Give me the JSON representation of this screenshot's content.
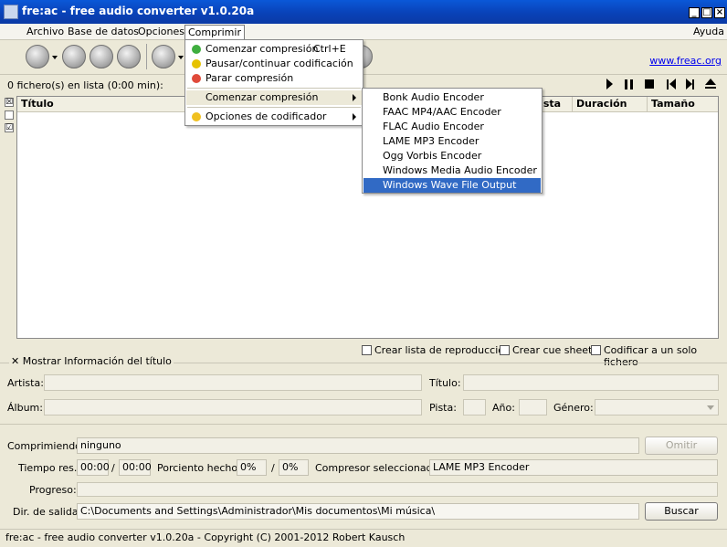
{
  "window": {
    "title": "fre:ac - free audio converter v1.0.20a",
    "controls": {
      "minimize": "_",
      "maximize": "□",
      "close": "×"
    }
  },
  "menubar": {
    "items": [
      "Archivo",
      "Base de datos",
      "Opciones",
      "Comprimir"
    ],
    "help": "Ayuda"
  },
  "link": "www.freac.org",
  "list": {
    "count_text": "0 fichero(s) en lista (0:00 min):",
    "columns": [
      "Título",
      "Pista",
      "Duración",
      "Tamaño"
    ],
    "check_marks": [
      "☒",
      "",
      "☑"
    ]
  },
  "comprimir_menu": {
    "items": [
      {
        "label": "Comenzar compresión",
        "shortcut": "Ctrl+E",
        "icon": "green-play-icon"
      },
      {
        "label": "Pausar/continuar codificación",
        "icon": "yellow-pause-icon"
      },
      {
        "label": "Parar compresión",
        "icon": "red-stop-icon"
      },
      {
        "label": "Comenzar compresión",
        "submenu": true
      },
      {
        "label": "Opciones de codificador",
        "submenu": true,
        "icon": "yellow-gear-icon"
      }
    ]
  },
  "encoder_submenu": {
    "items": [
      "Bonk Audio Encoder",
      "FAAC MP4/AAC Encoder",
      "FLAC Audio Encoder",
      "LAME MP3 Encoder",
      "Ogg Vorbis Encoder",
      "Windows Media Audio Encoder",
      "Windows Wave File Output"
    ],
    "highlighted_index": 6
  },
  "options": {
    "playlist": "Crear lista de reproducción",
    "cue": "Crear cue sheet",
    "single_file": "Codificar a un solo fichero"
  },
  "title_info": {
    "toggle_label": "Mostrar Información del título",
    "toggle_mark": "✕",
    "artist": "Artista:",
    "title": "Título:",
    "album": "Álbum:",
    "track": "Pista:",
    "year": "Año:",
    "genre": "Género:"
  },
  "progress": {
    "compressing_label": "Comprimiendo:",
    "compressing_value": "ninguno",
    "skip_button": "Omitir",
    "time_label": "Tiempo res.:",
    "time1": "00:00",
    "time2": "00:00",
    "slash": "/",
    "percent_label": "Porciento hecho:",
    "percent1": "0%",
    "percent2": "0%",
    "encoder_label": "Compresor seleccionado:",
    "encoder_value": "LAME MP3 Encoder",
    "progress_label": "Progreso:",
    "output_label": "Dir. de salida:",
    "output_value": "C:\\Documents and Settings\\Administrador\\Mis documentos\\Mi música\\",
    "browse_button": "Buscar"
  },
  "statusbar": "fre:ac - free audio converter v1.0.20a - Copyright (C) 2001-2012 Robert Kausch"
}
